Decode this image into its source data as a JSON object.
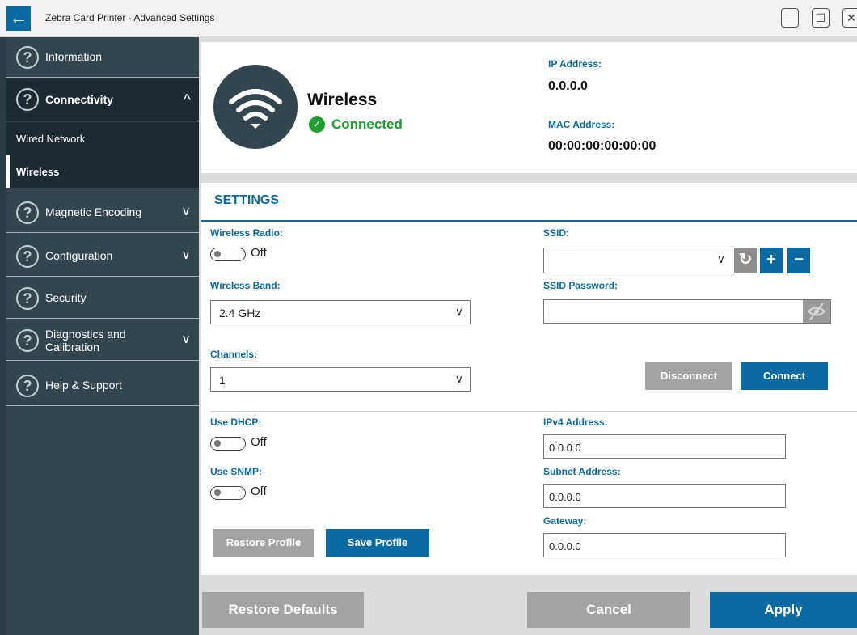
{
  "window": {
    "title": "Zebra Card Printer - Advanced Settings",
    "back_icon": "←",
    "minimize_icon": "—",
    "maximize_icon": "☐",
    "close_icon": "✕"
  },
  "sidebar": {
    "information": "Information",
    "connectivity": "Connectivity",
    "wired_network": "Wired Network",
    "wireless": "Wireless",
    "magnetic_encoding": "Magnetic Encoding",
    "configuration": "Configuration",
    "security": "Security",
    "diagnostics_line1": "Diagnostics and",
    "diagnostics_line2": "Calibration",
    "help": "Help & Support",
    "help_icon_glyph": "?",
    "chevron_up": "^",
    "chevron_down": "∨"
  },
  "header": {
    "title": "Wireless",
    "status": "Connected",
    "check_glyph": "✓",
    "ip_label": "IP Address:",
    "ip_value": "0.0.0.0",
    "mac_label": "MAC Address:",
    "mac_value": "00:00:00:00:00:00"
  },
  "settings": {
    "title": "SETTINGS",
    "wireless_radio_label": "Wireless Radio:",
    "wireless_radio_state": "Off",
    "wireless_band_label": "Wireless Band:",
    "wireless_band_value": "2.4 GHz",
    "channels_label": "Channels:",
    "channels_value": "1",
    "ssid_label": "SSID:",
    "ssid_value": "",
    "ssid_password_label": "SSID Password:",
    "ssid_password_value": "",
    "refresh_glyph": "↻",
    "add_glyph": "+",
    "remove_glyph": "−",
    "disconnect": "Disconnect",
    "connect": "Connect",
    "use_dhcp_label": "Use DHCP:",
    "use_dhcp_state": "Off",
    "use_snmp_label": "Use SNMP:",
    "use_snmp_state": "Off",
    "ipv4_label": "IPv4 Address:",
    "ipv4_value": "0.0.0.0",
    "subnet_label": "Subnet Address:",
    "subnet_value": "0.0.0.0",
    "gateway_label": "Gateway:",
    "gateway_value": "0.0.0.0",
    "restore_profile": "Restore Profile",
    "save_profile": "Save Profile",
    "select_arrow": "∨"
  },
  "footer": {
    "restore_defaults": "Restore Defaults",
    "cancel": "Cancel",
    "apply": "Apply"
  },
  "colors": {
    "accent": "#0b6aa2",
    "sidebar": "#33454f",
    "connected": "#1e9e2f",
    "disabled_button": "#a3a3a3"
  }
}
